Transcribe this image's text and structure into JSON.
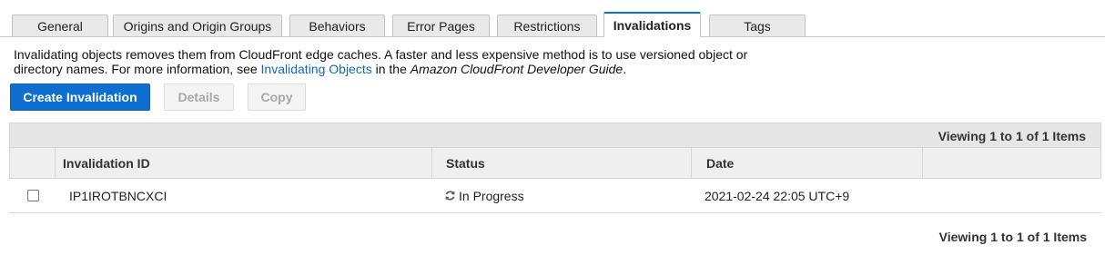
{
  "tabs": [
    {
      "label": "General",
      "active": false
    },
    {
      "label": "Origins and Origin Groups",
      "active": false
    },
    {
      "label": "Behaviors",
      "active": false
    },
    {
      "label": "Error Pages",
      "active": false
    },
    {
      "label": "Restrictions",
      "active": false
    },
    {
      "label": "Invalidations",
      "active": true
    },
    {
      "label": "Tags",
      "active": false
    }
  ],
  "description": {
    "text_before": "Invalidating objects removes them from CloudFront edge caches. A faster and less expensive method is to use versioned object or directory names. For more information, see ",
    "link_text": "Invalidating Objects",
    "text_middle": " in the ",
    "guide_name": "Amazon CloudFront Developer Guide",
    "text_after": "."
  },
  "actions": {
    "create_label": "Create Invalidation",
    "details_label": "Details",
    "copy_label": "Copy"
  },
  "table": {
    "viewing_top": "Viewing 1 to 1 of 1 Items",
    "columns": [
      "Invalidation ID",
      "Status",
      "Date"
    ],
    "rows": [
      {
        "id": "IP1IROTBNCXCI",
        "status": "In Progress",
        "status_icon": "refresh-icon",
        "date": "2021-02-24 22:05 UTC+9",
        "checked": false
      }
    ],
    "viewing_bottom": "Viewing 1 to 1 of 1 Items"
  },
  "colors": {
    "accent": "#0e6fd1",
    "link": "#1166bb"
  }
}
